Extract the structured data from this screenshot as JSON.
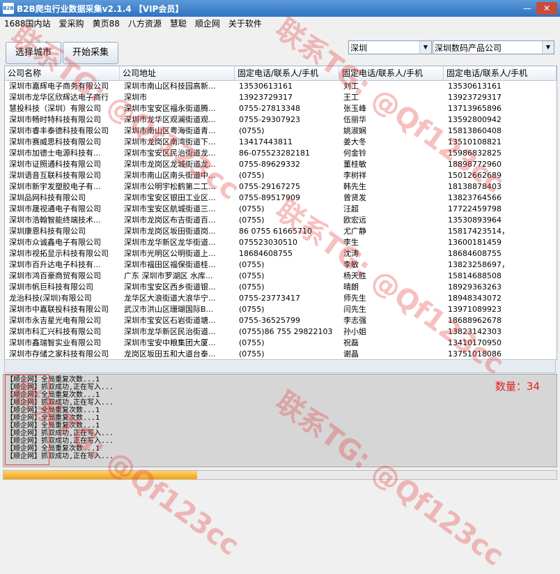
{
  "window": {
    "title": "B2B爬虫行业数据采集v2.1.4 【VIP会员】",
    "icon_text": "B2B"
  },
  "menu": [
    "1688国内站",
    "爱采购",
    "黄页88",
    "八方资源",
    "慧聪",
    "顺企网",
    "关于软件"
  ],
  "toolbar": {
    "select_city": "选择城市",
    "start": "开始采集",
    "city_value": "深圳",
    "keyword_value": "深圳数码产品公司"
  },
  "table": {
    "headers": [
      "公司名称",
      "公司地址",
      "固定电话/联系人/手机",
      "固定电话/联系人/手机",
      "固定电话/联系人/手机"
    ],
    "rows": [
      [
        "深圳市嘉辉电子商务有限公司",
        "深圳市南山区科技园高新...",
        "13530613161",
        "刘工",
        "13530613161"
      ],
      [
        "深圳市龙华区欣辉达电子商行",
        "深圳市",
        "13923729317",
        "王工",
        "13923729317"
      ],
      [
        "慧投科技（深圳）有限公司",
        "深圳市宝安区福永街道腾...",
        "0755-27813348",
        "张玉峰",
        "13713965896"
      ],
      [
        "深圳市畅时特科技有限公司",
        "深圳市龙华区观澜街道观...",
        "0755-29307923",
        "伍丽华",
        "13592800942"
      ],
      [
        "深圳市睿丰泰德科技有限公司",
        "深圳市南山区粤海街道青...",
        "(0755)",
        "姚淑娴",
        "15813860408"
      ],
      [
        "深圳市赛威思科技有限公司",
        "深圳市龙岗区南湾街道下...",
        "13417443811",
        "姜大冬",
        "13510108821"
      ],
      [
        "深圳市加德士电源科技有...",
        "深圳市宝安区民治街道龙...",
        "86-075523282181",
        "何金铃",
        "15986832825"
      ],
      [
        "深圳市证照通科技有限公司",
        "深圳市龙岗区龙城街道龙...",
        "0755-89629332",
        "董桂敏",
        "18898772960"
      ],
      [
        "深圳语音互联科技有限公司",
        "深圳市南山区南头街道中...",
        "(0755)",
        "李树祥",
        "15012662689"
      ],
      [
        "深圳市新宇发塑胶电子有...",
        "深圳市公明宇松鹤第二工...",
        "0755-29167275",
        "韩先生",
        "18138878403"
      ],
      [
        "深圳品网科技有限公司",
        "深圳市宝安区银田工业区...",
        "0755-89517909",
        "曾贤发",
        "13823764566"
      ],
      [
        "深圳市晟视通电子有限公司",
        "深圳市宝安区航城街道三...",
        "(0755)",
        "汪超",
        "17722459798"
      ],
      [
        "深圳市浩翰智能终端技术...",
        "深圳市龙岗区布吉街道百...",
        "(0755)",
        "欧宏远",
        "13530893964"
      ],
      [
        "深圳康恩科技有限公司",
        "深圳市龙岗区坂田街道岗...",
        "86 0755 61665710",
        "尤广静",
        "15817423514，"
      ],
      [
        "深圳市众诚鑫电子有限公司",
        "深圳市龙华新区龙华街道...",
        "075523030510",
        "李生",
        "13600181459"
      ],
      [
        "深圳市视拓显示科技有限公司",
        "深圳市光明区公明街道上...",
        "18684608755",
        "沈涛",
        "18684608755"
      ],
      [
        "深圳市百升达电子科技有...",
        "深圳市福田区福保街道桂...",
        "(0755)",
        "李敏",
        "13823258697，"
      ],
      [
        "深圳市鸿百豪商贸有限公司",
        "广东 深圳市罗湖区 水库...",
        "(0755)",
        "杨天胜",
        "15814688508"
      ],
      [
        "深圳市帆巨科技有限公司",
        "深圳市宝安区西乡街道银...",
        "(0755)",
        "晴朗",
        "18929363263"
      ],
      [
        "龙治科技(深圳)有限公司",
        "龙华区大浪街道大浪华宁...",
        "0755-23773417",
        "师先生",
        "18948343072"
      ],
      [
        "深圳市中嘉联投科技有限公司",
        "武汉市洪山区珊瑚国际B...",
        "(0755)",
        "闫先生",
        "13971089923"
      ],
      [
        "深圳市永吉星光电有限公司",
        "深圳市宝安区石岩街道塘...",
        "0755-36525799",
        "李志强",
        "18688962678"
      ],
      [
        "深圳市科汇兴科技有限公司",
        "深圳市龙华新区民治街道...",
        "(0755)86 755 29822103",
        "孙小姐",
        "13823142303"
      ],
      [
        "深圳市鑫瑞智实业有限公司",
        "深圳市宝安中粮集团大厦...",
        "(0755)",
        "祝磊",
        "13410170950"
      ],
      [
        "深圳市存储之家科技有限公司",
        "龙岗区坂田五和大道台泰...",
        "(0755)",
        "谢晶",
        "13751018086"
      ]
    ]
  },
  "log": {
    "lines": [
      "【顺企网】全局重复次数...1",
      "【顺企网】抓取成功,正在写入...",
      "【顺企网】全局重复次数...1",
      "【顺企网】抓取成功,正在写入...",
      "【顺企网】全局重复次数...1",
      "【顺企网】全局重复次数...1",
      "【顺企网】全局重复次数...1",
      "【顺企网】抓取成功,正在写入...",
      "【顺企网】抓取成功,正在写入...",
      "【顺企网】全局重复次数...1",
      "【顺企网】抓取成功,正在写入..."
    ],
    "count_label": "数量：34"
  },
  "progress": {
    "fraction": 0.35
  },
  "watermark": "联系TG: @Qf123cc",
  "colors": {
    "titlebar": "#2f73c1",
    "count": "#e02020",
    "progress": "#f0a21a"
  }
}
